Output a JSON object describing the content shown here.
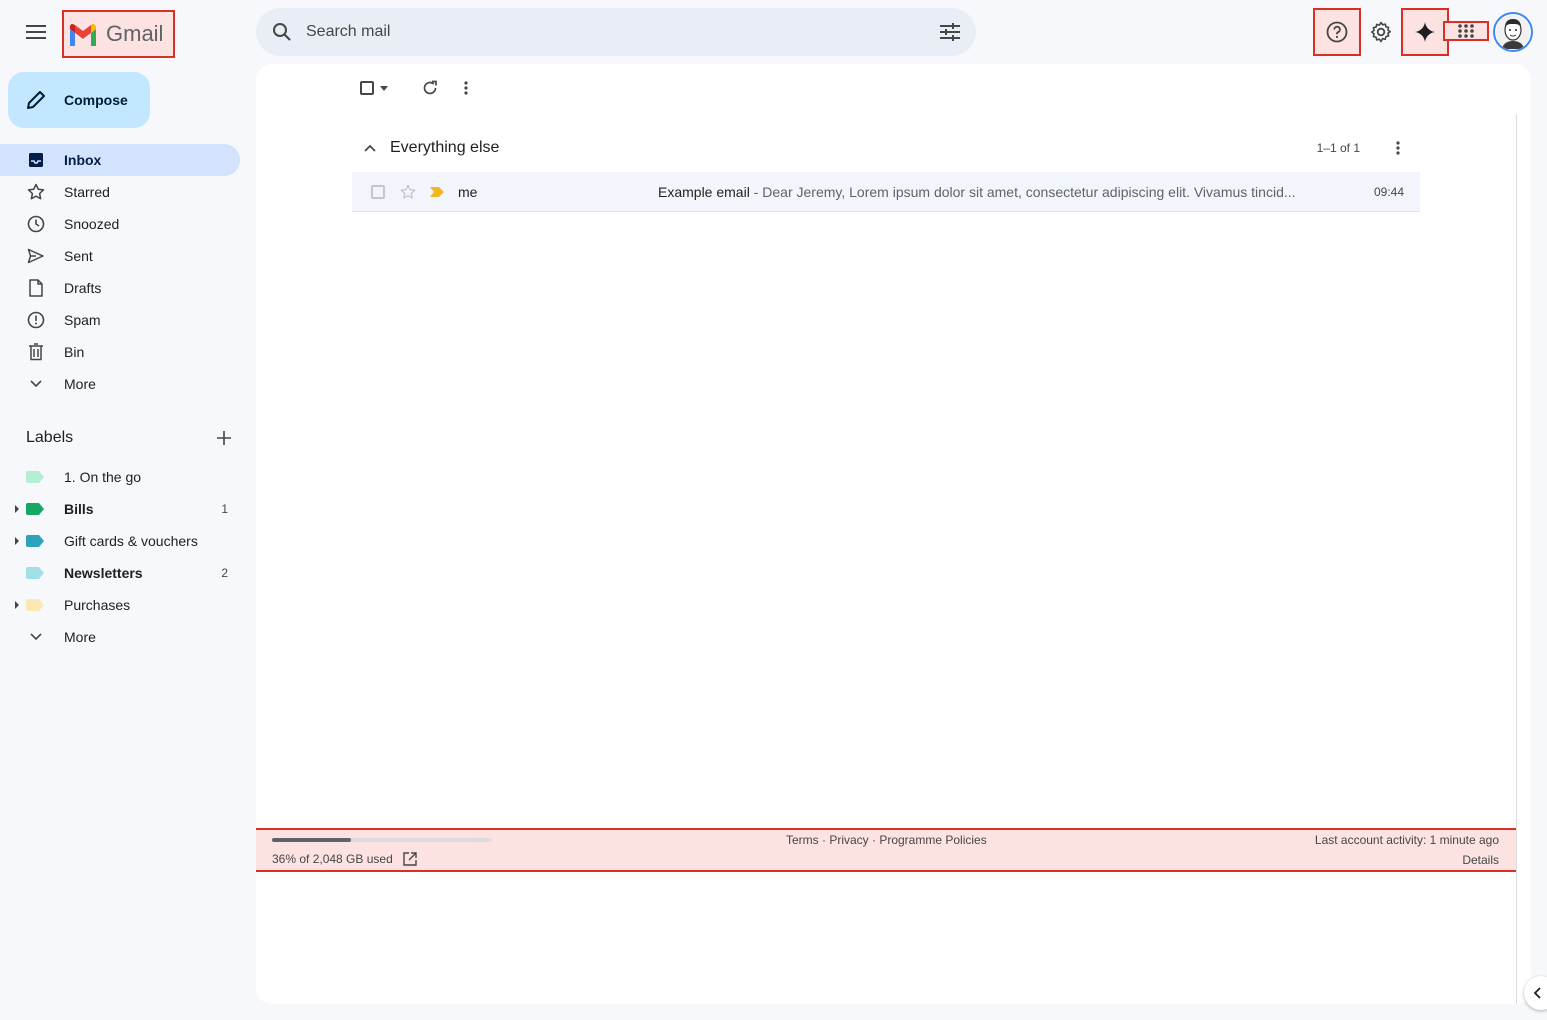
{
  "header": {
    "app_name": "Gmail",
    "search_placeholder": "Search mail"
  },
  "sidebar": {
    "compose_label": "Compose",
    "items": [
      {
        "label": "Inbox",
        "icon": "inbox-icon",
        "active": true
      },
      {
        "label": "Starred",
        "icon": "star-icon"
      },
      {
        "label": "Snoozed",
        "icon": "clock-icon"
      },
      {
        "label": "Sent",
        "icon": "send-icon"
      },
      {
        "label": "Drafts",
        "icon": "draft-icon"
      },
      {
        "label": "Spam",
        "icon": "spam-icon"
      },
      {
        "label": "Bin",
        "icon": "trash-icon"
      },
      {
        "label": "More",
        "icon": "chevron-down-icon"
      }
    ],
    "labels_title": "Labels",
    "labels": [
      {
        "name": "1. On the go",
        "color": "#b3efd3",
        "expandable": false,
        "bold": false,
        "count": ""
      },
      {
        "name": "Bills",
        "color": "#16a765",
        "expandable": true,
        "bold": true,
        "count": "1"
      },
      {
        "name": "Gift cards & vouchers",
        "color": "#2da2bb",
        "expandable": true,
        "bold": false,
        "count": ""
      },
      {
        "name": "Newsletters",
        "color": "#9fe1e7",
        "expandable": false,
        "bold": true,
        "count": "2"
      },
      {
        "name": "Purchases",
        "color": "#fce8b3",
        "expandable": true,
        "bold": false,
        "count": ""
      }
    ],
    "labels_more": "More"
  },
  "main": {
    "section_title": "Everything else",
    "pager": "1–1 of 1",
    "emails": [
      {
        "sender": "me",
        "subject": "Example email",
        "snippet": " - Dear Jeremy, Lorem ipsum dolor sit amet, consectetur adipiscing elit. Vivamus tincid...",
        "time": "09:44"
      }
    ]
  },
  "footer": {
    "storage_used_fraction": 0.36,
    "storage_text": "36% of 2,048 GB used",
    "links": "Terms · Privacy · Programme Policies",
    "activity": "Last account activity: 1 minute ago",
    "details": "Details"
  },
  "colors": {
    "compose_bg": "#c2e7ff",
    "active_nav_bg": "#d3e3fd",
    "important_marker": "#f2b824"
  }
}
